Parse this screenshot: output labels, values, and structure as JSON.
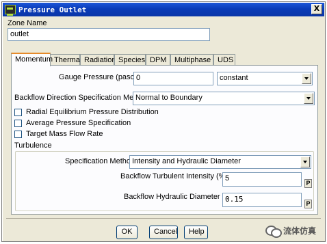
{
  "window": {
    "title": "Pressure Outlet",
    "close_glyph": "X"
  },
  "zone": {
    "label": "Zone Name",
    "value": "outlet"
  },
  "tabs": [
    {
      "label": "Momentum",
      "active": true
    },
    {
      "label": "Thermal"
    },
    {
      "label": "Radiation"
    },
    {
      "label": "Species"
    },
    {
      "label": "DPM"
    },
    {
      "label": "Multiphase"
    },
    {
      "label": "UDS"
    }
  ],
  "momentum": {
    "gauge_label": "Gauge Pressure (pascal)",
    "gauge_value": "0",
    "gauge_method": "constant",
    "backflow_dir_label": "Backflow Direction Specification Method",
    "backflow_dir_value": "Normal to Boundary",
    "checkboxes": [
      {
        "label": "Radial Equilibrium Pressure Distribution",
        "checked": false
      },
      {
        "label": "Average Pressure Specification",
        "checked": false
      },
      {
        "label": "Target Mass Flow Rate",
        "checked": false
      }
    ],
    "turbulence": {
      "heading": "Turbulence",
      "spec_label": "Specification Method",
      "spec_value": "Intensity and Hydraulic Diameter",
      "intensity_label": "Backflow Turbulent Intensity (%)",
      "intensity_value": "5",
      "diameter_label": "Backflow Hydraulic Diameter (m)",
      "diameter_value": "0.15",
      "param_glyph": "P"
    }
  },
  "buttons": {
    "ok": "OK",
    "cancel": "Cancel",
    "help": "Help"
  },
  "watermark": {
    "text": "流体仿真"
  }
}
